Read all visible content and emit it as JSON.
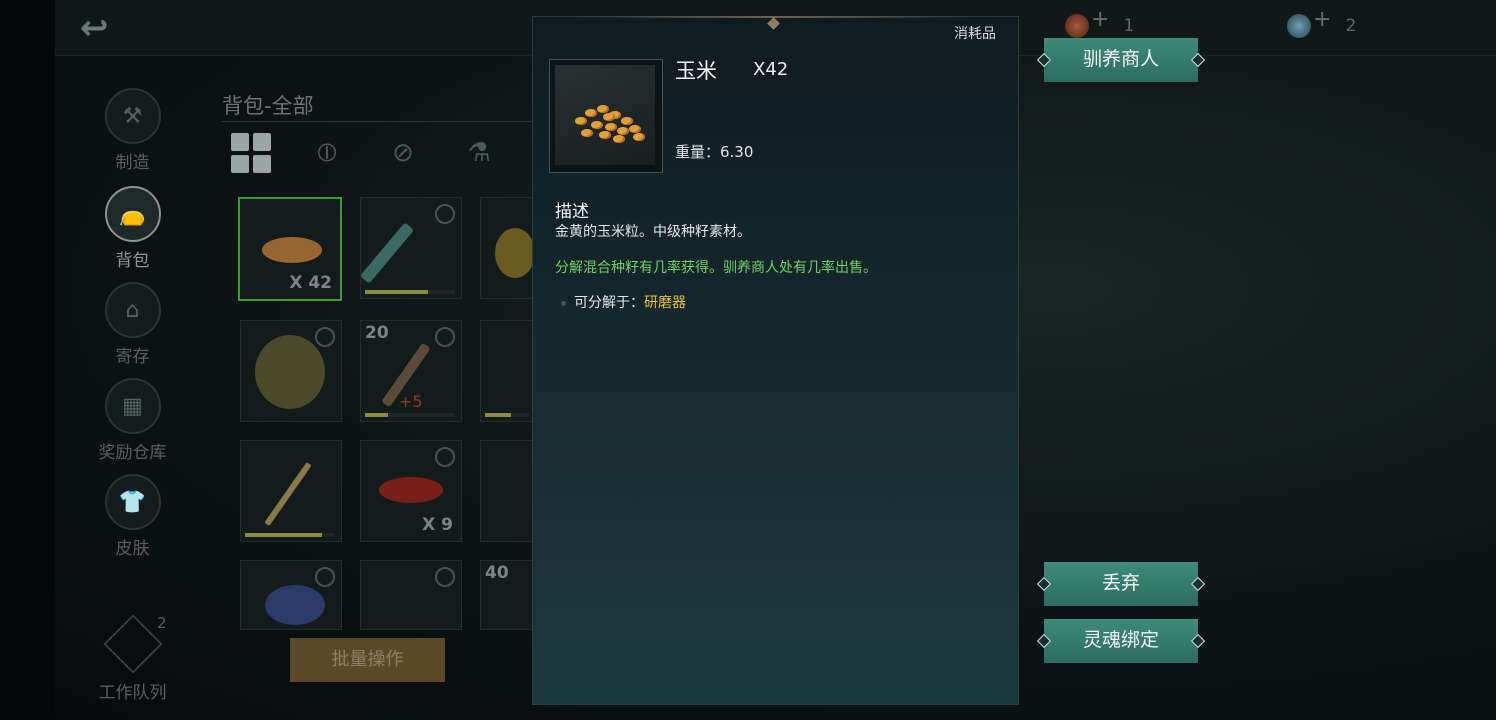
{
  "currency": [
    {
      "icon": "soul-coin-icon",
      "value": "1"
    },
    {
      "icon": "globe-coin-icon",
      "value": "2"
    }
  ],
  "sidenav": [
    {
      "label": "制造",
      "icon": "craft-icon"
    },
    {
      "label": "背包",
      "icon": "bag-icon",
      "active": true
    },
    {
      "label": "寄存",
      "icon": "storage-icon"
    },
    {
      "label": "奖励仓库",
      "icon": "reward-warehouse-icon"
    },
    {
      "label": "皮肤",
      "icon": "skin-icon"
    }
  ],
  "bag": {
    "title": "背包-全部",
    "batch_label": "批量操作",
    "slots": {
      "s1_qty": "X 42",
      "s5_top": "20",
      "s5_plus": "+5",
      "s8_qty": "X 9",
      "s12_top": "40"
    }
  },
  "work_queue": {
    "label": "工作队列",
    "badge": "2"
  },
  "item": {
    "category": "消耗品",
    "name": "玉米",
    "qty": "X42",
    "weight": "重量：6.30",
    "desc_title": "描述",
    "desc": "金黄的玉米粒。中级种籽素材。",
    "obtain": "分解混合种籽有几率获得。驯养商人处有几率出售。",
    "decompose_label": "可分解于：",
    "decompose_tool": "研磨器"
  },
  "actions": {
    "tame_merchant": "驯养商人",
    "discard": "丢弃",
    "soul_bind": "灵魂绑定"
  },
  "colors": {
    "accent_green": "#6fd06a",
    "tool_yellow": "#e8c23a",
    "button_teal": "#3f8a78"
  }
}
